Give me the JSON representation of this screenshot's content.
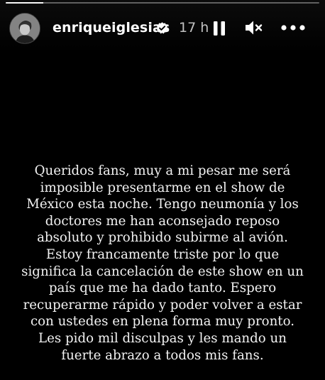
{
  "story": {
    "progress_fraction": 0.12
  },
  "header": {
    "username": "enriqueiglesias",
    "verified_icon": "verified-badge-icon",
    "timestamp": "17 h",
    "pause_icon": "pause-icon",
    "mute_icon": "speaker-muted-icon",
    "more_icon": "more-options-icon"
  },
  "message": {
    "lines": [
      "Queridos fans, muy a mi pesar me será",
      "imposible presentarme en el show de",
      "México esta noche. Tengo neumonía y los",
      "doctores me han aconsejado reposo",
      "absoluto y prohibido subirme al avión.",
      "Estoy francamente triste por lo que",
      "significa la cancelación de este show en un",
      "país que me ha dado tanto.  Espero",
      "recuperarme rápido y poder volver a estar",
      "con ustedes en plena forma muy pronto.",
      "Les pido mil disculpas y les mando un",
      "fuerte abrazo a todos mis fans."
    ]
  },
  "colors": {
    "background": "#000000",
    "text": "#f2f2f2",
    "verified": "#ffffff"
  }
}
